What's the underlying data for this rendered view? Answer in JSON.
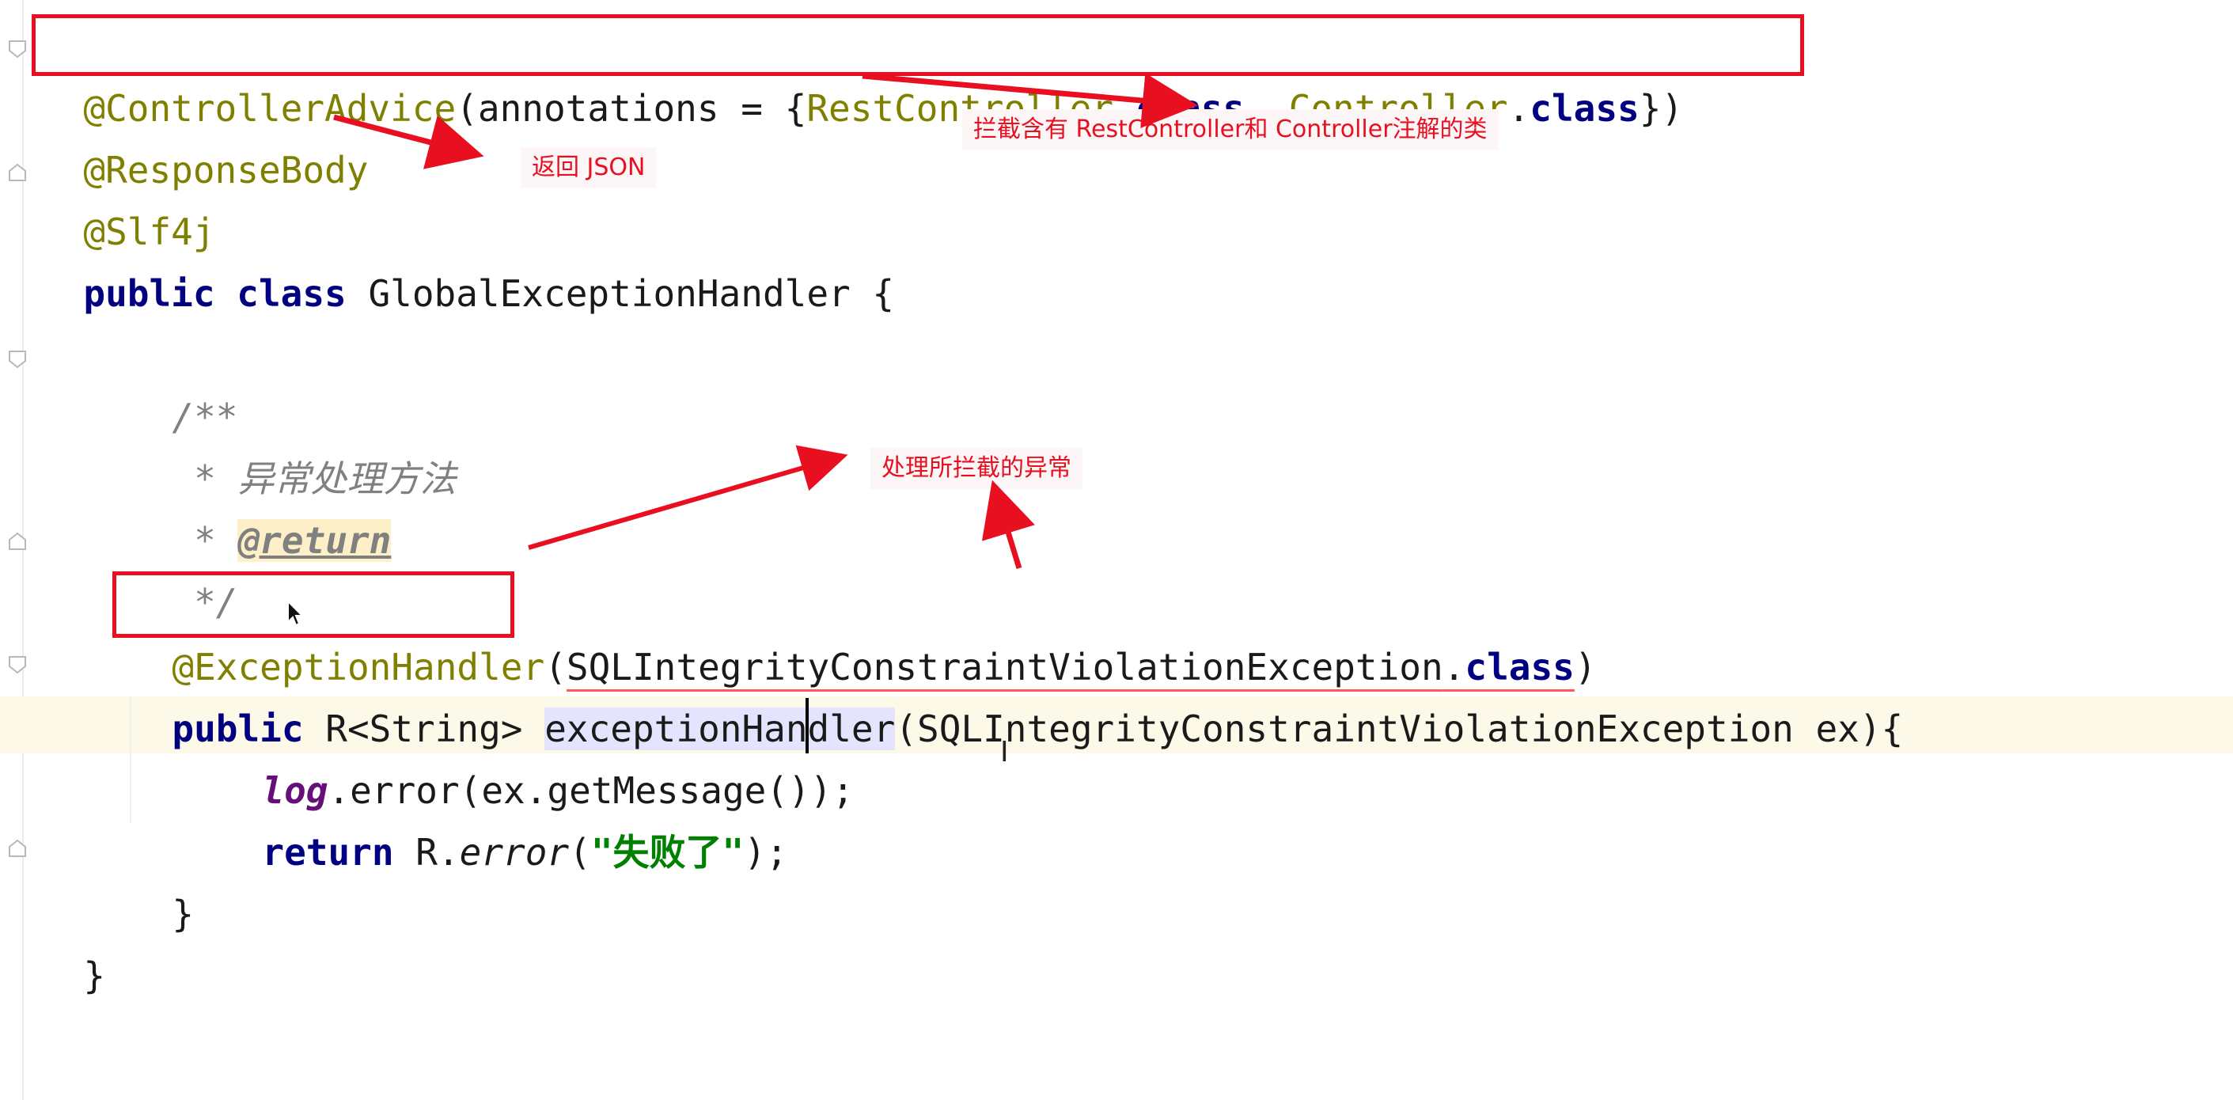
{
  "editor": {
    "language": "java",
    "lines": {
      "l1_ann": "@ControllerAdvice",
      "l1_args_open": "(annotations = {",
      "l1_rest": "RestController",
      "l1_dot1": ".",
      "l1_class1": "class",
      "l1_sep": ", ",
      "l1_ctrl": "Controller",
      "l1_dot2": ".",
      "l1_class2": "class",
      "l1_close": "})",
      "l2": "@ResponseBody",
      "l3": "@Slf4j",
      "l4_public": "public",
      "l4_class": "class",
      "l4_name": " GlobalExceptionHandler {",
      "c1": "/**",
      "c2_star": " * ",
      "c2_text": "异常处理方法",
      "c3_star": " * ",
      "c3_tag": "@return",
      "c4": " */",
      "eh_ann": "@ExceptionHandler",
      "eh_open": "(",
      "eh_type": "SQLIntegrityConstraintViolationException",
      "eh_dot": ".",
      "eh_class": "class",
      "eh_close": ")",
      "m_public": "public",
      "m_ret": " R<String> ",
      "m_name": "exceptionHandler",
      "m_params": "(SQLIntegrityConstraintViolationException ex){",
      "b1_log": "log",
      "b1_rest": ".error(ex.getMessage());",
      "b2_return": "return",
      "b2_r": " R.",
      "b2_err": "error",
      "b2_open": "(",
      "b2_str": "\"失败了\"",
      "b2_close": ");",
      "close_method": "}",
      "close_class": "}"
    }
  },
  "annotations": {
    "note_controller": "拦截含有 RestController和 Controller注解的类",
    "note_json": "返回 JSON",
    "note_exception": "处理所拦截的异常"
  },
  "colors": {
    "annotation_red": "#e81020",
    "keyword": "#000080",
    "annotation": "#808000",
    "string": "#008000",
    "comment": "#808080",
    "current_line": "#fcf9e9"
  }
}
